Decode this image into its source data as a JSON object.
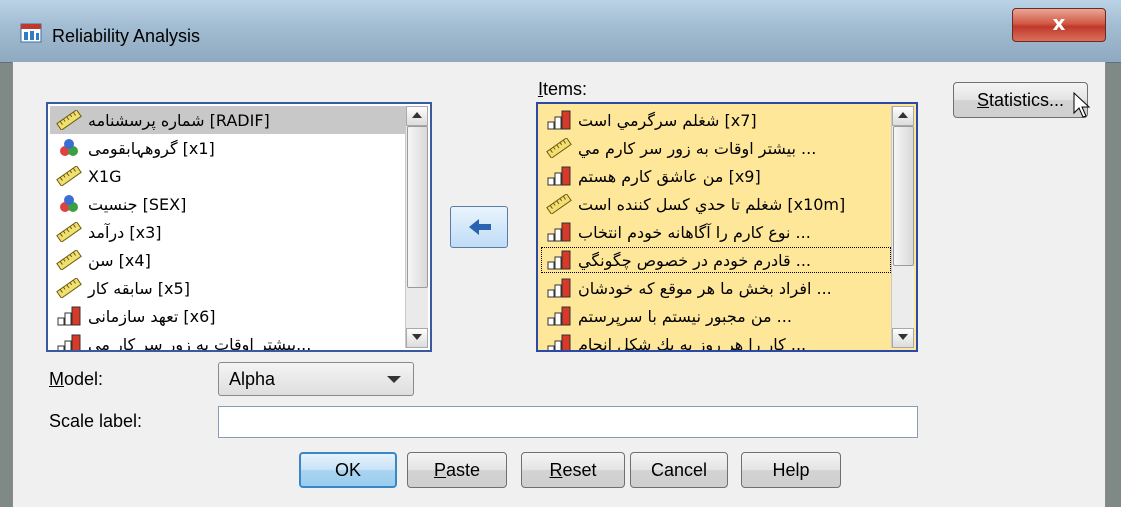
{
  "window": {
    "title": "Reliability Analysis",
    "close_glyph": "x"
  },
  "variables_list": {
    "items": [
      {
        "label": "شماره پرسشنامه [RADIF]",
        "icon": "ruler-icon",
        "selected": true
      },
      {
        "label": "گروهہابقومی [x1]",
        "icon": "nominal-balls-icon"
      },
      {
        "label": "X1G",
        "icon": "ruler-icon"
      },
      {
        "label": "جنسیت [SEX]",
        "icon": "nominal-balls-icon"
      },
      {
        "label": "درآمد [x3]",
        "icon": "ruler-icon"
      },
      {
        "label": "سن [x4]",
        "icon": "ruler-icon"
      },
      {
        "label": "سابقه کار [x5]",
        "icon": "ruler-icon"
      },
      {
        "label": "تعهد سازمانی [x6]",
        "icon": "ordinal-bars-icon"
      },
      {
        "label": "بیشتر اوقات به زور سر کار می...",
        "icon": "ordinal-bars-icon"
      }
    ]
  },
  "items_panel": {
    "label": "Items:",
    "items": [
      {
        "label": "شغلم سرگرمي است [x7]",
        "icon": "ordinal-bars-icon"
      },
      {
        "label": "بيشتر اوقات به زور سر كارم مي ...",
        "icon": "ruler-icon"
      },
      {
        "label": "من عاشق كارم هستم [x9]",
        "icon": "ordinal-bars-icon"
      },
      {
        "label": "شغلم تا حدي كسل كننده است [x10m]",
        "icon": "ruler-icon"
      },
      {
        "label": "نوع كارم را آگاهانه خودم انتخاب ...",
        "icon": "ordinal-bars-icon"
      },
      {
        "label": "قادرم خودم در خصوص چگونگي ...",
        "icon": "ordinal-bars-icon",
        "focused": true
      },
      {
        "label": "افراد بخش ما هر موقع كه خودشان ...",
        "icon": "ordinal-bars-icon"
      },
      {
        "label": "من مجبور نيستم با سرپرستم ...",
        "icon": "ordinal-bars-icon"
      },
      {
        "label": "كار را هر روز به يك شكل انجام ...",
        "icon": "ordinal-bars-icon"
      }
    ]
  },
  "move_button": {
    "icon": "arrow-left-icon"
  },
  "statistics_button": {
    "label": "Statistics..."
  },
  "model": {
    "label": "Model:",
    "value": "Alpha"
  },
  "scale_label": {
    "label": "Scale label:",
    "value": ""
  },
  "buttons": {
    "ok": "OK",
    "paste": "Paste",
    "reset": "Reset",
    "cancel": "Cancel",
    "help": "Help"
  }
}
